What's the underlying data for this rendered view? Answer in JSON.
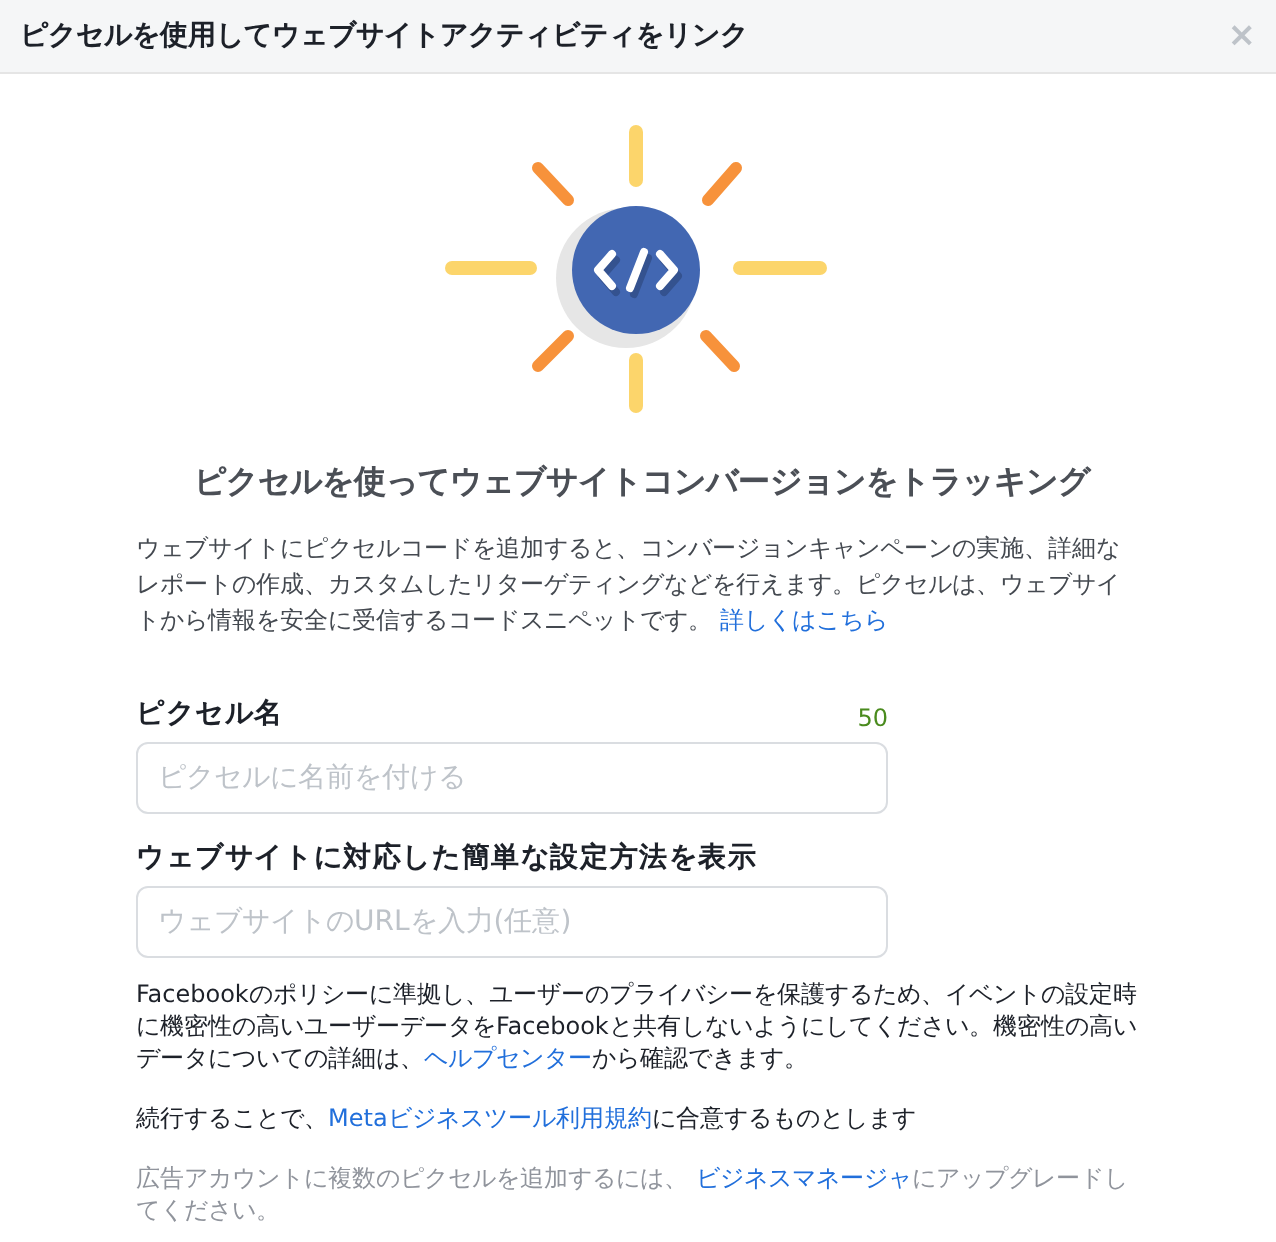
{
  "dialog": {
    "title": "ピクセルを使用してウェブサイトアクティビティをリンク",
    "close": "×"
  },
  "heading": "ピクセルを使ってウェブサイトコンバージョンをトラッキング",
  "intro": [
    {
      "kind": "text",
      "text": "ウェブサイトにピクセルコードを追加すると、コンバージョンキャンペーンの実施、詳細なレポートの作成、カスタムしたリターゲティングなどを行えます。ピクセルは、ウェブサイトから情報を安全に受信するコードスニペットです。 "
    },
    {
      "kind": "link",
      "text": "詳しくはこちら"
    }
  ],
  "fields": [
    {
      "label": "ピクセル名",
      "counter": "50",
      "placeholder": "ピクセルに名前を付ける"
    },
    {
      "label": "ウェブサイトに対応した簡単な設定方法を表示",
      "placeholder": "ウェブサイトのURLを入力(任意)"
    }
  ],
  "notes": [
    {
      "kind": "normal",
      "segments": [
        {
          "kind": "text",
          "text": "Facebookのポリシーに準拠し、ユーザーのプライバシーを保護するため、イベントの設定時に機密性の高いユーザーデータをFacebookと共有しないようにしてください。機密性の高いデータについての詳細は、"
        },
        {
          "kind": "link",
          "text": "ヘルプセンター"
        },
        {
          "kind": "text",
          "text": "から確認できます。"
        }
      ]
    },
    {
      "kind": "normal",
      "segments": [
        {
          "kind": "text",
          "text": "続行することで、"
        },
        {
          "kind": "link",
          "text": "Metaビジネスツール利用規約"
        },
        {
          "kind": "text",
          "text": "に合意するものとします"
        }
      ]
    },
    {
      "kind": "muted",
      "segments": [
        {
          "kind": "text",
          "text": "広告アカウントに複数のピクセルを追加するには、 "
        },
        {
          "kind": "link",
          "text": "ビジネスマネージャ"
        },
        {
          "kind": "text",
          "text": "にアップグレードしてください。"
        }
      ]
    }
  ]
}
